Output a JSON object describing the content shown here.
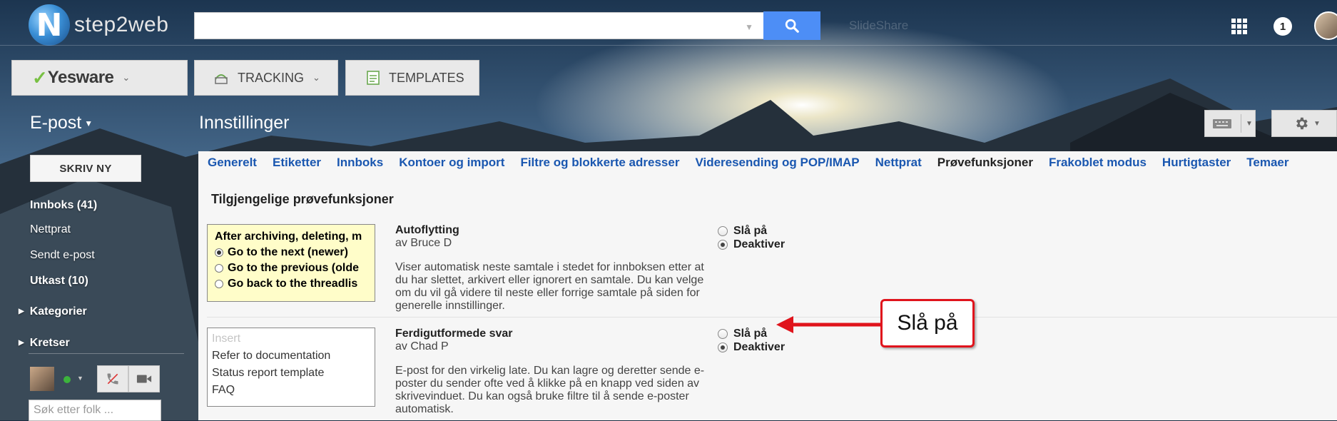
{
  "header": {
    "logo_text": "step2web",
    "logo_mark": "N",
    "search_value": "",
    "ghost_text": "SlideShare",
    "notification_count": "1"
  },
  "toolbar": {
    "yesware_label": "Yesware",
    "tracking_label": "TRACKING",
    "templates_label": "TEMPLATES"
  },
  "nav": {
    "app_label": "E-post",
    "page_title": "Innstillinger"
  },
  "sidebar": {
    "compose_label": "SKRIV NY",
    "items": [
      {
        "label": "Innboks (41)"
      },
      {
        "label": "Nettprat"
      },
      {
        "label": "Sendt e-post"
      },
      {
        "label": "Utkast (10)"
      }
    ],
    "sections": [
      {
        "label": "Kategorier"
      },
      {
        "label": "Kretser"
      }
    ],
    "people_search_placeholder": "Søk etter folk ..."
  },
  "tabs": [
    {
      "label": "Generelt"
    },
    {
      "label": "Etiketter"
    },
    {
      "label": "Innboks"
    },
    {
      "label": "Kontoer og import"
    },
    {
      "label": "Filtre og blokkerte adresser"
    },
    {
      "label": "Videresending og POP/IMAP"
    },
    {
      "label": "Nettprat"
    },
    {
      "label": "Prøvefunksjoner"
    },
    {
      "label": "Frakoblet modus"
    },
    {
      "label": "Hurtigtaster"
    },
    {
      "label": "Temaer"
    }
  ],
  "labs": {
    "section_title": "Tilgjengelige prøvefunksjoner",
    "items": [
      {
        "name": "Autoflytting",
        "author": "av Bruce D",
        "description": "Viser automatisk neste samtale i stedet for innboksen etter at du har slettet, arkivert eller ignorert en samtale. Du kan velge om du vil gå videre til neste eller forrige samtale på siden for generelle innstillinger.",
        "option_on": "Slå på",
        "option_off": "Deaktiver",
        "preview": {
          "heading": "After archiving, deleting, m",
          "lines": [
            "Go to the next (newer)",
            "Go to the previous (olde",
            "Go back to the threadlis"
          ]
        }
      },
      {
        "name": "Ferdigutformede svar",
        "author": "av Chad P",
        "description": "E-post for den virkelig late. Du kan lagre og deretter sende e-poster du sender ofte ved å klikke på en knapp ved siden av skrivevinduet. Du kan også bruke filtre til å sende e-poster automatisk.",
        "option_on": "Slå på",
        "option_off": "Deaktiver",
        "preview": {
          "muted": "Insert",
          "lines": [
            "Refer to documentation",
            "Status report template",
            "FAQ"
          ]
        }
      }
    ]
  },
  "annotation": {
    "callout_text": "Slå på"
  },
  "colors": {
    "accent_blue": "#4d8ef6",
    "link_blue": "#1a57b0",
    "annotation_red": "#e0141c",
    "yesware_green": "#78c043"
  },
  "icons": [
    "search-icon",
    "apps-grid-icon",
    "keyboard-icon",
    "gear-icon",
    "phone-icon",
    "video-icon",
    "tracking-icon",
    "templates-icon"
  ]
}
